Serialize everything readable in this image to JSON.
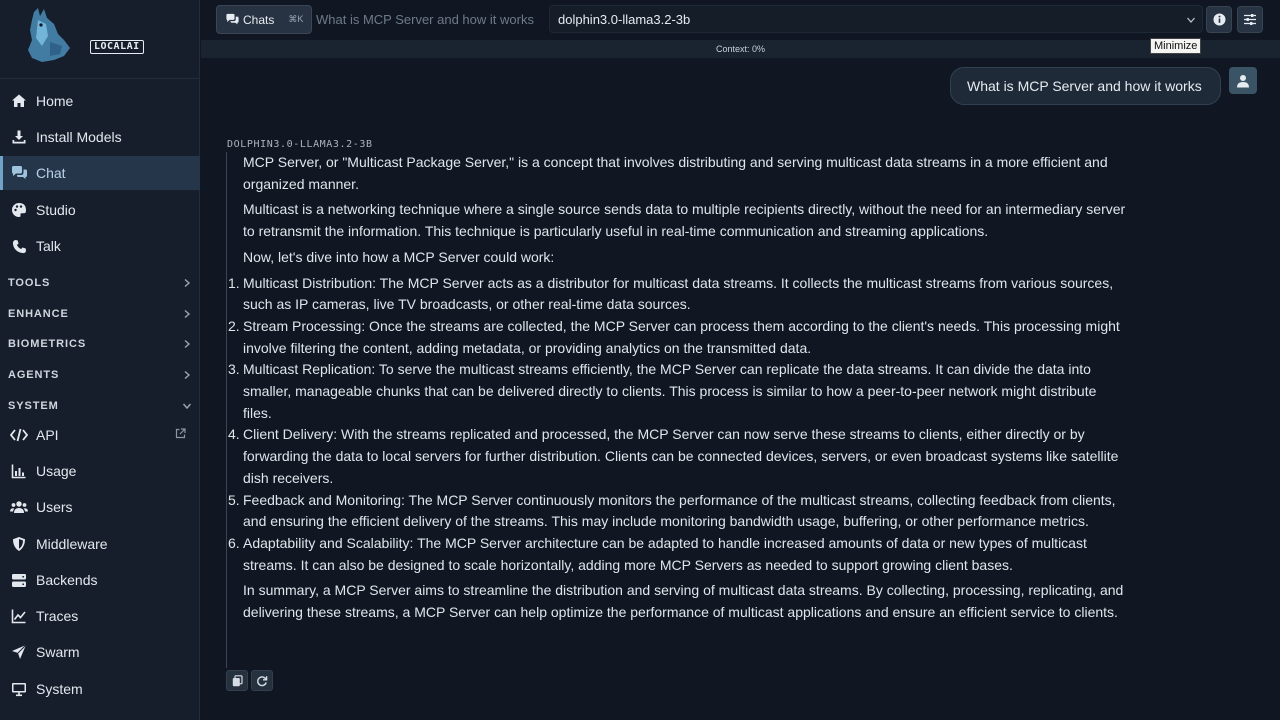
{
  "app": {
    "logo_text": "LOCALAI"
  },
  "sidebar": {
    "items_top": [
      {
        "label": "Home",
        "icon": "home-icon"
      },
      {
        "label": "Install Models",
        "icon": "download-icon"
      },
      {
        "label": "Chat",
        "icon": "chat-icon",
        "active": true
      },
      {
        "label": "Studio",
        "icon": "palette-icon"
      },
      {
        "label": "Talk",
        "icon": "phone-icon"
      }
    ],
    "sections": [
      {
        "label": "TOOLS",
        "expanded": false
      },
      {
        "label": "ENHANCE",
        "expanded": false
      },
      {
        "label": "BIOMETRICS",
        "expanded": false
      },
      {
        "label": "AGENTS",
        "expanded": false
      },
      {
        "label": "SYSTEM",
        "expanded": true
      }
    ],
    "items_system": [
      {
        "label": "API",
        "icon": "code-icon",
        "external": true
      },
      {
        "label": "Usage",
        "icon": "chart-icon"
      },
      {
        "label": "Users",
        "icon": "users-icon"
      },
      {
        "label": "Middleware",
        "icon": "shield-icon"
      },
      {
        "label": "Backends",
        "icon": "server-icon"
      },
      {
        "label": "Traces",
        "icon": "trace-icon"
      },
      {
        "label": "Swarm",
        "icon": "send-icon"
      },
      {
        "label": "System",
        "icon": "monitor-icon"
      }
    ]
  },
  "topbar": {
    "chats_label": "Chats",
    "chats_shortcut": "⌘K",
    "chat_title": "What is MCP Server and how it works",
    "model": "dolphin3.0-llama3.2-3b",
    "tooltip": "Minimize"
  },
  "context": {
    "label": "Context: 0%"
  },
  "conversation": {
    "user_message": "What is MCP Server and how it works",
    "model_label": "DOLPHIN3.0-LLAMA3.2-3B",
    "p1": "MCP Server, or \"Multicast Package Server,\" is a concept that involves distributing and serving multicast data streams in a more efficient and organized manner.",
    "p2": "Multicast is a networking technique where a single source sends data to multiple recipients directly, without the need for an intermediary server to retransmit the information. This technique is particularly useful in real-time communication and streaming applications.",
    "p3": "Now, let's dive into how a MCP Server could work:",
    "list": [
      {
        "num": "1.",
        "text": "Multicast Distribution: The MCP Server acts as a distributor for multicast data streams. It collects the multicast streams from various sources, such as IP cameras, live TV broadcasts, or other real-time data sources."
      },
      {
        "num": "2.",
        "text": "Stream Processing: Once the streams are collected, the MCP Server can process them according to the client's needs. This processing might involve filtering the content, adding metadata, or providing analytics on the transmitted data."
      },
      {
        "num": "3.",
        "text": "Multicast Replication: To serve the multicast streams efficiently, the MCP Server can replicate the data streams. It can divide the data into smaller, manageable chunks that can be delivered directly to clients. This process is similar to how a peer-to-peer network might distribute files."
      },
      {
        "num": "4.",
        "text": "Client Delivery: With the streams replicated and processed, the MCP Server can now serve these streams to clients, either directly or by forwarding the data to local servers for further distribution. Clients can be connected devices, servers, or even broadcast systems like satellite dish receivers."
      },
      {
        "num": "5.",
        "text": "Feedback and Monitoring: The MCP Server continuously monitors the performance of the multicast streams, collecting feedback from clients, and ensuring the efficient delivery of the streams. This may include monitoring bandwidth usage, buffering, or other performance metrics."
      },
      {
        "num": "6.",
        "text": "Adaptability and Scalability: The MCP Server architecture can be adapted to handle increased amounts of data or new types of multicast streams. It can also be designed to scale horizontally, adding more MCP Servers as needed to support growing client bases."
      }
    ],
    "summary": "In summary, a MCP Server aims to streamline the distribution and serving of multicast data streams. By collecting, processing, replicating, and delivering these streams, a MCP Server can help optimize the performance of multicast applications and ensure an efficient service to clients."
  },
  "colors": {
    "accent": "#6fa3c8",
    "background": "#101722",
    "sidebar": "#161e2b"
  }
}
